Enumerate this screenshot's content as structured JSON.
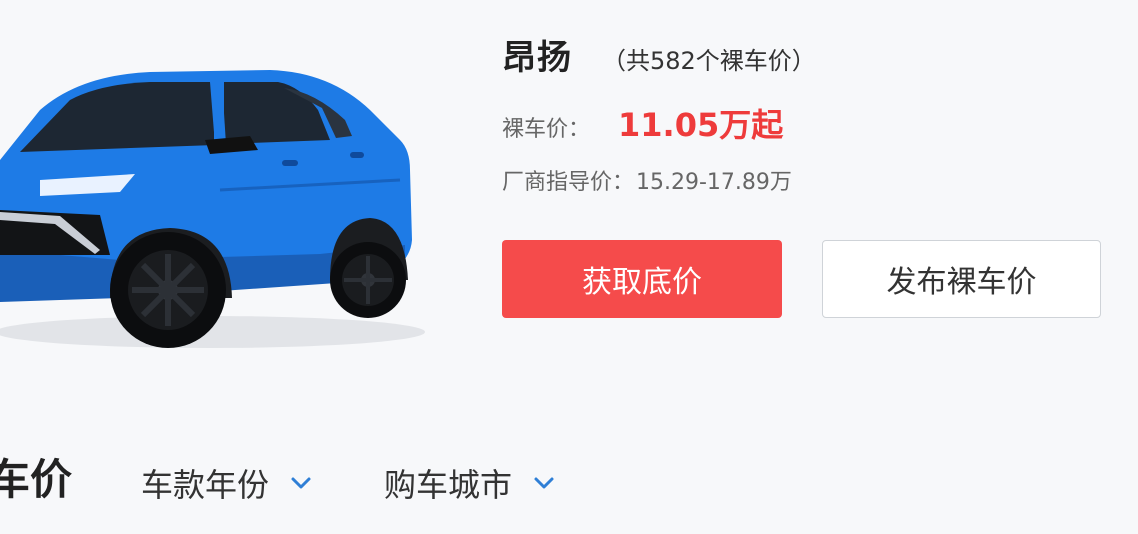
{
  "model": {
    "name": "昂扬",
    "price_count": "（共582个裸车价）"
  },
  "price": {
    "label": "裸车价：",
    "value": "11.05万起"
  },
  "msrp": {
    "label": "厂商指导价：",
    "value": "15.29-17.89万"
  },
  "actions": {
    "primary_label": "获取底价",
    "secondary_label": "发布裸车价"
  },
  "filters": {
    "section_title": "车价",
    "year_label": "车款年份",
    "city_label": "购车城市"
  },
  "colors": {
    "accent_red": "#f54b4b",
    "price_red": "#ee3b3b",
    "car_blue": "#1e7be6",
    "chevron_blue": "#2f7fd6"
  },
  "icons": {
    "year_dropdown": "chevron-down-icon",
    "city_dropdown": "chevron-down-icon"
  }
}
